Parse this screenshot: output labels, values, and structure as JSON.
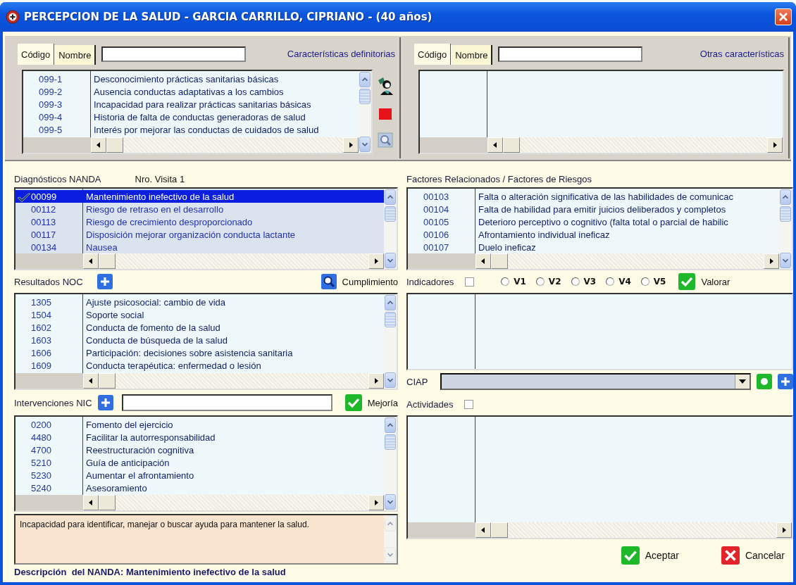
{
  "window": {
    "title": "PERCEPCION DE LA SALUD - GARCIA CARRILLO, CIPRIANO - (40 años)"
  },
  "characteristics": {
    "tabs": [
      {
        "label": "Código",
        "selected": true
      },
      {
        "label": "Nombre",
        "selected": false
      }
    ],
    "label": "Características definitorias",
    "rows": [
      {
        "code": "099-1",
        "name": "Desconocimiento prácticas sanitarias básicas"
      },
      {
        "code": "099-2",
        "name": "Ausencia conductas adaptativas a los cambios"
      },
      {
        "code": "099-3",
        "name": "Incapacidad para realizar prácticas sanitarias básicas"
      },
      {
        "code": "099-4",
        "name": "Historia de falta de conductas generadoras de salud"
      },
      {
        "code": "099-5",
        "name": "Interés por mejorar las conductas de cuidados de salud"
      }
    ]
  },
  "other_characteristics": {
    "tabs": [
      {
        "label": "Código",
        "selected": true
      },
      {
        "label": "Nombre",
        "selected": false
      }
    ],
    "label": "Otras características"
  },
  "nanda": {
    "label": "Diagnósticos NANDA",
    "visit": "Nro. Visita 1",
    "rows": [
      {
        "code": "00099",
        "name": "Mantenimiento inefectivo de la salud",
        "selected": true
      },
      {
        "code": "00112",
        "name": "Riesgo de retraso en el desarrollo",
        "selected": false
      },
      {
        "code": "00113",
        "name": "Riesgo de crecimiento desproporcionado",
        "selected": false
      },
      {
        "code": "00117",
        "name": "Disposición mejorar organización conducta lactante",
        "selected": false
      },
      {
        "code": "00134",
        "name": "Nausea",
        "selected": false
      }
    ]
  },
  "factors": {
    "label": "Factores Relacionados / Factores de Riesgos",
    "rows": [
      {
        "code": "00103",
        "name": "Falta o alteración significativa de las habilidades de comunicac"
      },
      {
        "code": "00104",
        "name": "Falta de habilidad para emitir juicios deliberados y completos"
      },
      {
        "code": "00105",
        "name": "Deterioro perceptivo o cognitivo (falta total o parcial de habilic"
      },
      {
        "code": "00106",
        "name": "Afrontamiento individual ineficaz"
      },
      {
        "code": "00107",
        "name": "Duelo ineficaz"
      }
    ]
  },
  "noc": {
    "label": "Resultados NOC",
    "button": "Cumplimiento",
    "rows": [
      {
        "code": "1305",
        "name": "Ajuste psicosocial: cambio de vida"
      },
      {
        "code": "1504",
        "name": "Soporte social"
      },
      {
        "code": "1602",
        "name": "Conducta de fomento de la salud"
      },
      {
        "code": "1603",
        "name": "Conducta de búsqueda de la salud"
      },
      {
        "code": "1606",
        "name": "Participación: decisiones sobre asistencia sanitaria"
      },
      {
        "code": "1609",
        "name": "Conducta terapéutica: enfermedad o lesión"
      }
    ]
  },
  "indicators": {
    "label": "Indicadores",
    "checked": false,
    "options": [
      {
        "label": "V1",
        "selected": false
      },
      {
        "label": "V2",
        "selected": false
      },
      {
        "label": "V3",
        "selected": false
      },
      {
        "label": "V4",
        "selected": false
      },
      {
        "label": "V5",
        "selected": false
      }
    ],
    "button": "Valorar"
  },
  "ciap": {
    "label": "CIAP"
  },
  "nic": {
    "label": "Intervenciones NIC",
    "button": "Mejoría",
    "rows": [
      {
        "code": "0200",
        "name": "Fomento del ejercicio"
      },
      {
        "code": "4480",
        "name": "Facilitar la autorresponsabilidad"
      },
      {
        "code": "4700",
        "name": "Reestructuración cognitiva"
      },
      {
        "code": "5210",
        "name": "Guía de anticipación"
      },
      {
        "code": "5230",
        "name": "Aumentar el afrontamiento"
      },
      {
        "code": "5240",
        "name": "Asesoramiento"
      }
    ]
  },
  "activities": {
    "label": "Actividades",
    "checked": false
  },
  "description": {
    "text": "Incapacidad para identificar, manejar o buscar ayuda para mantener la salud.",
    "caption": "Descripción  del NANDA: Mantenimiento inefectivo de la salud"
  },
  "buttons": [
    {
      "label": "Aceptar",
      "kind": "accept"
    },
    {
      "label": "Cancelar",
      "kind": "cancel"
    }
  ]
}
